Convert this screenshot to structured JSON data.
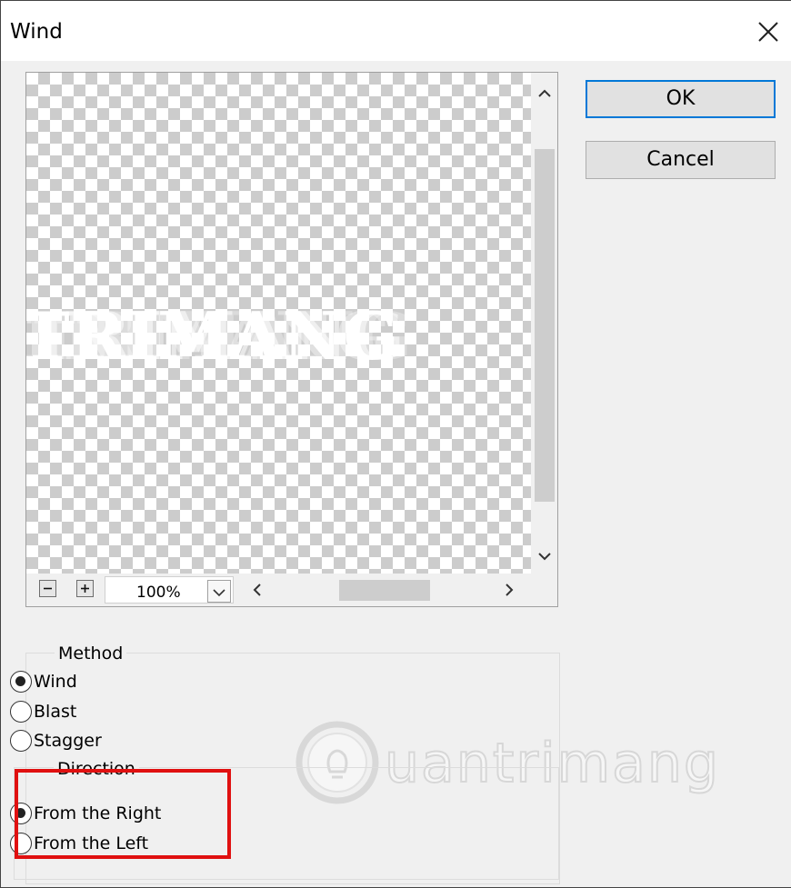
{
  "window": {
    "title": "Wind"
  },
  "preview": {
    "text": "TRIMANG",
    "zoom": "100%"
  },
  "buttons": {
    "ok": "OK",
    "cancel": "Cancel"
  },
  "method": {
    "legend": "Method",
    "options": [
      {
        "label": "Wind",
        "selected": true
      },
      {
        "label": "Blast",
        "selected": false
      },
      {
        "label": "Stagger",
        "selected": false
      }
    ]
  },
  "direction": {
    "legend": "Direction",
    "options": [
      {
        "label": "From the Right",
        "selected": true
      },
      {
        "label": "From the Left",
        "selected": false
      }
    ]
  },
  "watermark": {
    "text": "uantrimang"
  },
  "colors": {
    "highlight": "#e01010",
    "ok_border": "#0078d7"
  },
  "icons": {
    "close": "close-icon",
    "zoom_out": "minus-icon",
    "zoom_in": "plus-icon",
    "dropdown": "chevron-down-icon"
  }
}
